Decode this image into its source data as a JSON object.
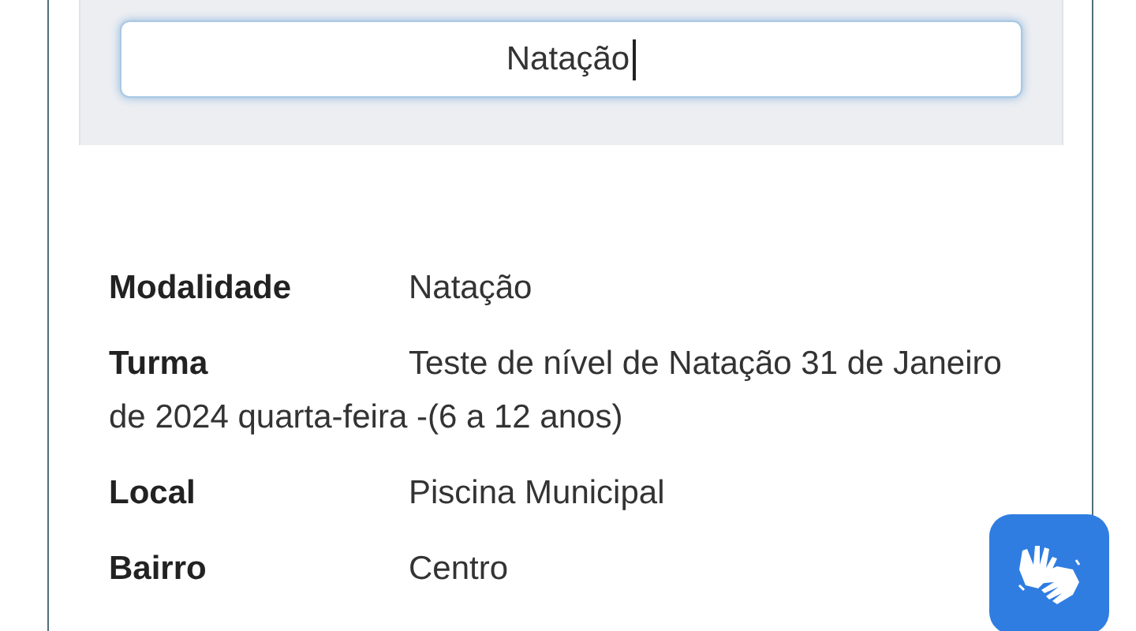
{
  "search": {
    "value": "Natação"
  },
  "details": [
    {
      "label": "Modalidade",
      "value_lines": [
        "Natação"
      ]
    },
    {
      "label": "Turma",
      "value_lines": [
        "Teste de nível de Natação 31 de Janeiro",
        "de 2024 quarta-feira -(6 a 12 anos)"
      ]
    },
    {
      "label": "Local",
      "value_lines": [
        "Piscina Municipal"
      ]
    },
    {
      "label": "Bairro",
      "value_lines": [
        "Centro"
      ]
    }
  ]
}
